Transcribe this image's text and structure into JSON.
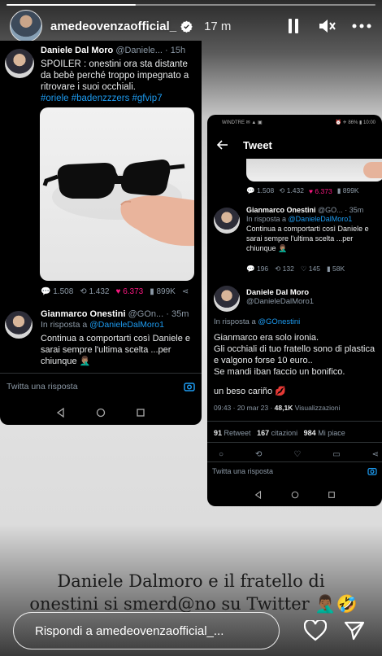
{
  "story": {
    "progress": 0.35,
    "username": "amedeovenzaofficial_",
    "time": "17 m",
    "caption_line1": "Daniele Dalmoro e il fratello di",
    "caption_line2": "onestini si smerd@no su Twitter",
    "caption_emoji": "🤦🏾‍♂️🤣",
    "reply_placeholder": "Rispondi a amedeovenzaofficial_...",
    "icons": [
      "verified-badge-icon",
      "pause-icon",
      "mute-icon",
      "more-icon",
      "heart-icon",
      "send-icon"
    ]
  },
  "left_screen": {
    "tweet": {
      "name": "Daniele Dal Moro",
      "handle": "@Daniele...",
      "time": "· 15h",
      "text": "SPOILER : onestini ora sta distante da bebè perché troppo impegnato a ritrovare i suoi occhiali.",
      "hashtags": "#oriele #badenzzzers #gfvip7",
      "replies": "1.508",
      "retweets": "1.432",
      "likes": "6.373",
      "views": "899K"
    },
    "reply": {
      "name": "Gianmarco Onestini",
      "handle": "@GOn...",
      "time": "· 35m",
      "in_reply": "In risposta a",
      "in_reply_to": "@DanieleDalMoro1",
      "text": "Continua a comportarti così Daniele e sarai sempre l'ultima scelta ...per chiunque 🤦🏽‍♂️"
    },
    "reply_placeholder": "Twitta una risposta"
  },
  "right_screen": {
    "status_left": "WINDTRE ✉ ▲ ▣",
    "status_right": "⏰ ✈ 86% ▮ 10:00",
    "title": "Tweet",
    "top_stats": {
      "replies": "1.508",
      "retweets": "1.432",
      "likes": "6.373",
      "views": "899K"
    },
    "reply": {
      "name": "Gianmarco Onestini",
      "handle": "@GO...",
      "time": "· 35m",
      "in_reply": "In risposta a",
      "in_reply_to": "@DanieleDalMoro1",
      "text": "Continua a comportarti così Daniele e sarai sempre l'ultima scelta ...per chiunque 🤦🏽‍♂️",
      "replies": "196",
      "retweets": "132",
      "likes": "145",
      "views": "58K"
    },
    "main": {
      "name": "Daniele Dal Moro",
      "handle": "@DanieleDalMoro1",
      "in_reply": "In risposta a",
      "in_reply_to": "@GOnestini",
      "text1": "Gianmarco era solo ironia.",
      "text2": "Gli occhiali di tuo fratello sono di plastica e valgono forse 10 euro..",
      "text3": "Se mandi iban faccio  un bonifico.",
      "text4": "un beso cariño 💋",
      "meta_time": "09:43 · 20 mar 23 ·",
      "meta_views": "48,1K",
      "meta_views_label": "Visualizzazioni",
      "retweets": "91",
      "retweets_label": "Retweet",
      "quotes": "167",
      "quotes_label": "citazioni",
      "likes": "984",
      "likes_label": "Mi piace"
    },
    "reply_placeholder": "Twitta una risposta"
  },
  "colors": {
    "twitter_blue": "#1d9bf0",
    "like_pink": "#f91880",
    "muted": "#8b98a5"
  }
}
